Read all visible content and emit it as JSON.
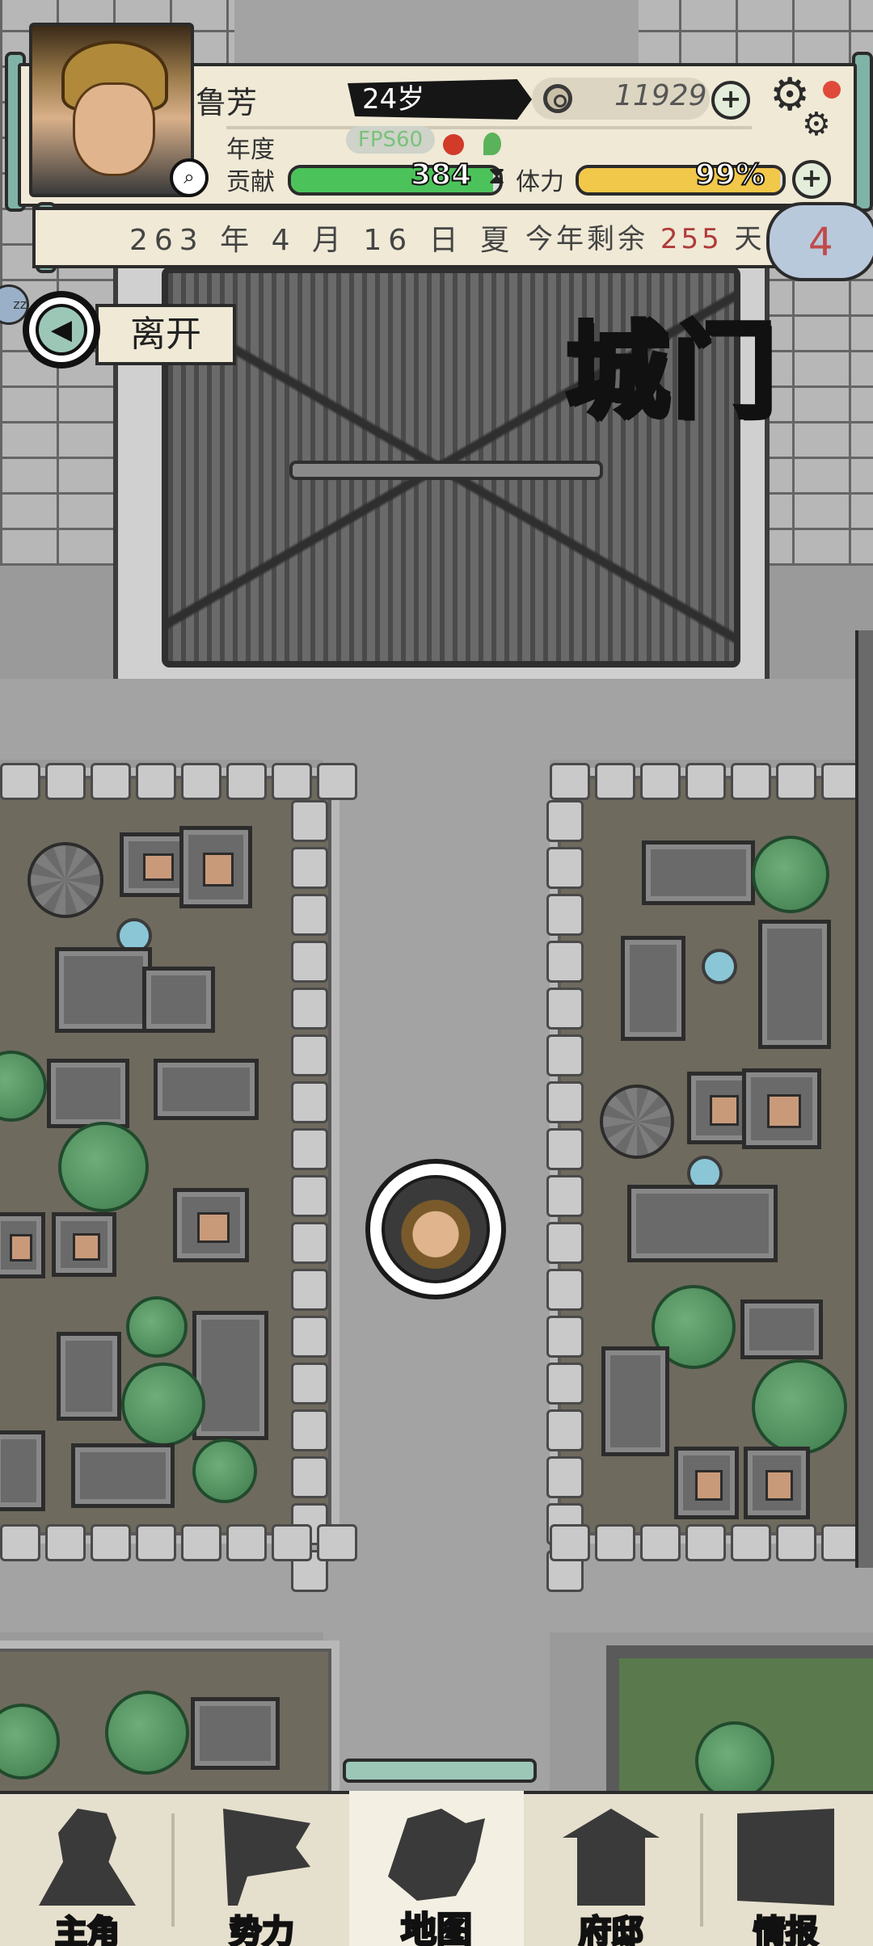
{
  "player": {
    "name": "鲁芳",
    "age": "24岁"
  },
  "currency": {
    "value": "11929"
  },
  "stats": {
    "year_label": "年度",
    "fps": "FPS60",
    "contribution_label": "贡献",
    "contribution_value": "384",
    "contribution_fill": 0.97,
    "stamina_label": "体力",
    "stamina_value": "99%",
    "stamina_fill": 0.99
  },
  "date": {
    "text": "263 年 4 月 16 日 夏",
    "remaining_prefix": "今年剩余",
    "remaining_days": "255",
    "remaining_suffix": "天"
  },
  "cloud_badge": "4",
  "sleep_badge": "zz",
  "location": {
    "title": "城门",
    "leave_label": "离开"
  },
  "nav": [
    {
      "label": "主角",
      "icon": "hero-icon"
    },
    {
      "label": "势力",
      "icon": "flag-icon"
    },
    {
      "label": "地图",
      "icon": "map-icon"
    },
    {
      "label": "府邸",
      "icon": "mansion-icon"
    },
    {
      "label": "情报",
      "icon": "scroll-icon"
    }
  ],
  "active_nav": "地图",
  "colors": {
    "contribution_bar": "#4cc35a",
    "stamina_bar": "#f2c84a",
    "accent_teal": "#7fb3a6",
    "panel": "#efe9d6"
  }
}
